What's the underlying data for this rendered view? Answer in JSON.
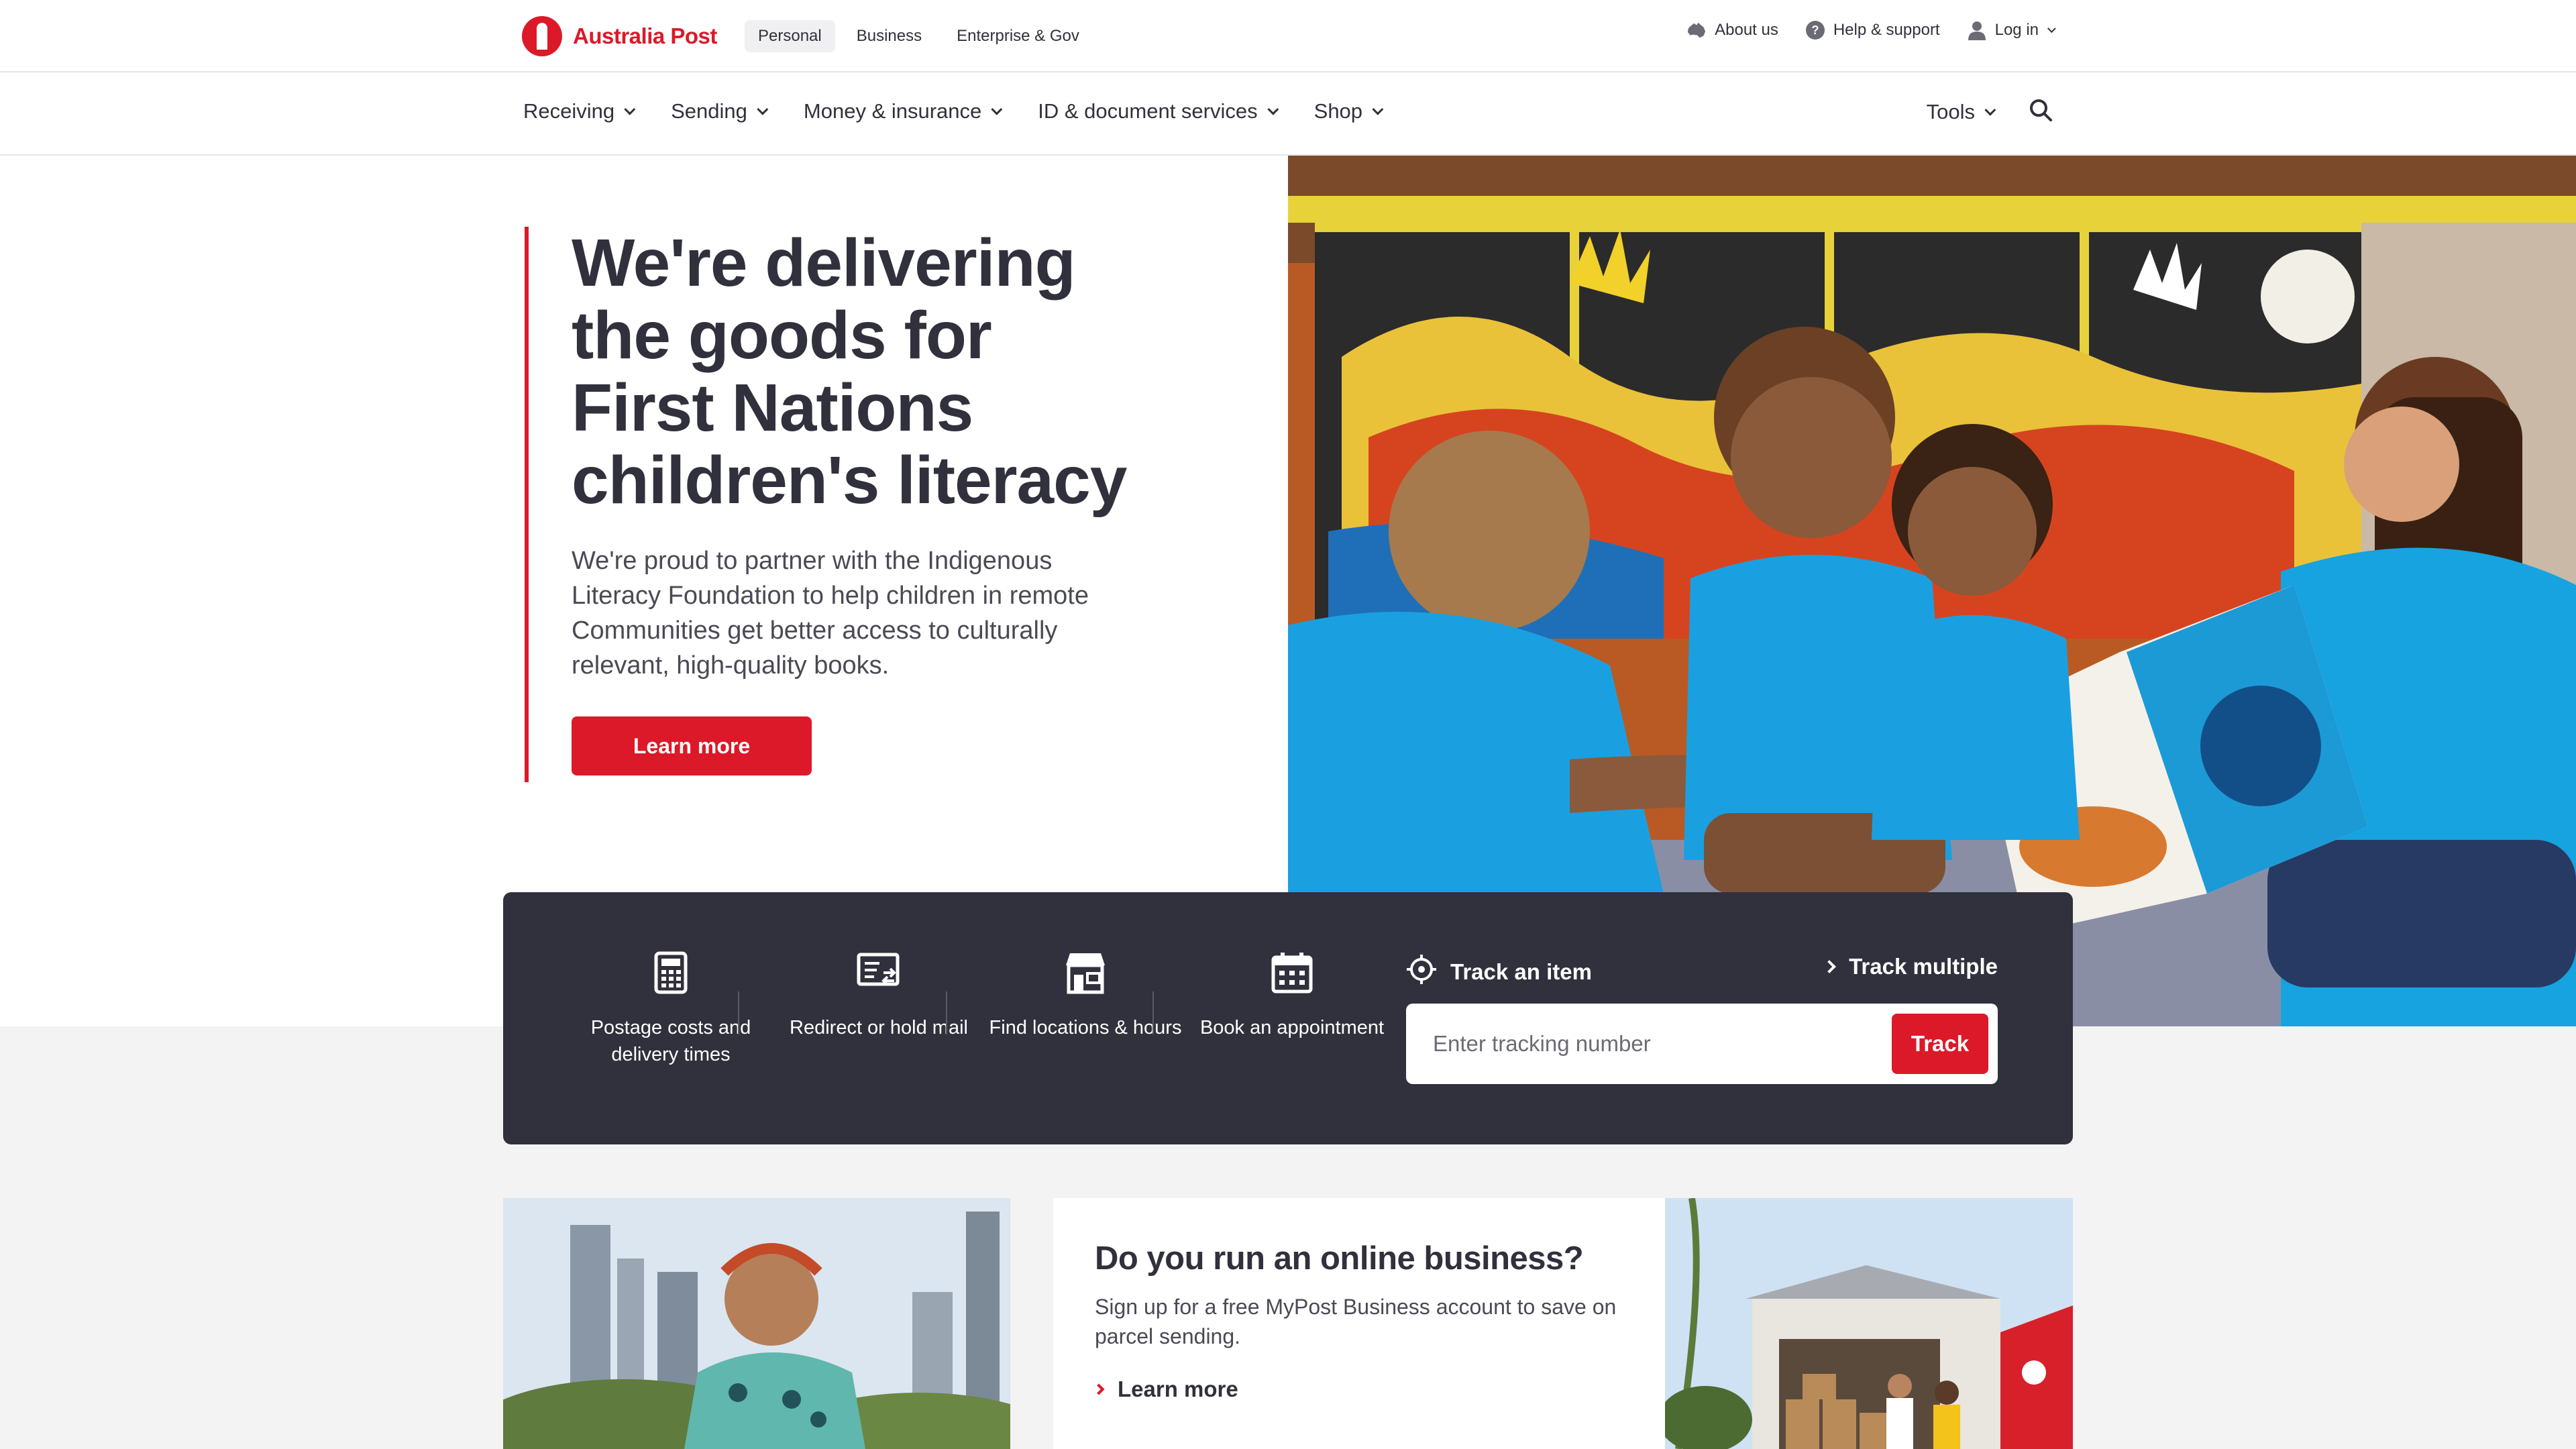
{
  "brand": {
    "name": "Australia Post",
    "color": "#dc1928",
    "dark": "#31313d"
  },
  "segments": [
    {
      "label": "Personal",
      "active": true
    },
    {
      "label": "Business",
      "active": false
    },
    {
      "label": "Enterprise & Gov",
      "active": false
    }
  ],
  "utility": {
    "about": "About us",
    "help": "Help & support",
    "login": "Log in"
  },
  "nav": {
    "items": [
      "Receiving",
      "Sending",
      "Money & insurance",
      "ID & document services",
      "Shop"
    ],
    "tools": "Tools"
  },
  "hero": {
    "title": "We're delivering the goods for First Nations children's literacy",
    "body": "We're proud to partner with the Indigenous Literacy Foundation to help children in remote Communities get better access to culturally relevant, high-quality books.",
    "cta": "Learn more"
  },
  "quicklinks": [
    {
      "icon": "calculator-icon",
      "label": "Postage costs and delivery times"
    },
    {
      "icon": "redirect-mail-icon",
      "label": "Redirect or hold mail"
    },
    {
      "icon": "post-office-icon",
      "label": "Find locations & hours"
    },
    {
      "icon": "calendar-icon",
      "label": "Book an appointment"
    }
  ],
  "tracking": {
    "heading": "Track an item",
    "multiple": "Track multiple",
    "placeholder": "Enter tracking number",
    "button": "Track"
  },
  "promo": {
    "title": "Do you run an online business?",
    "body": "Sign up for a free MyPost Business account to save on parcel sending.",
    "link": "Learn more"
  }
}
